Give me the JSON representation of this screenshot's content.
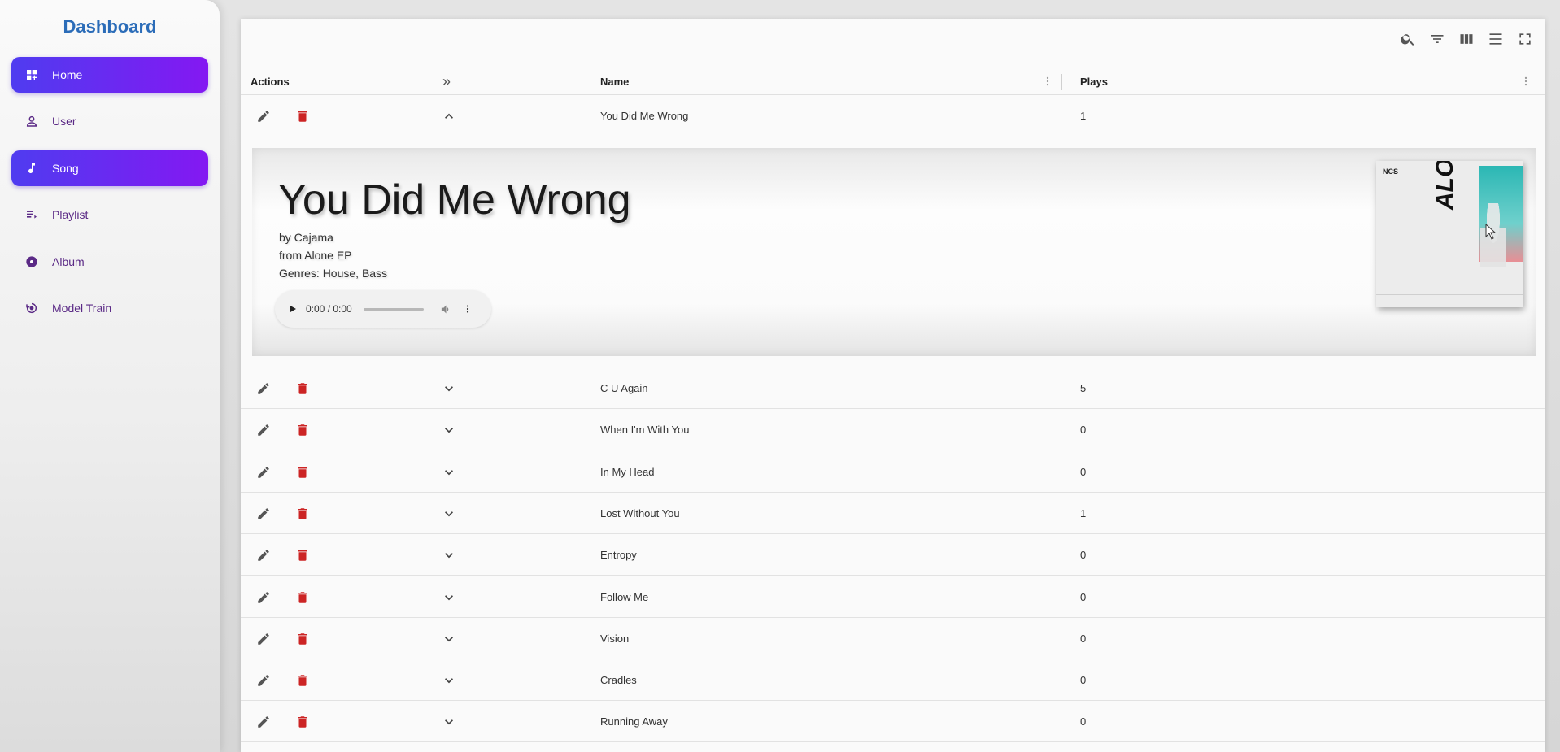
{
  "sidebar": {
    "title": "Dashboard",
    "items": [
      {
        "label": "Home",
        "icon": "dashboard-icon",
        "active": true
      },
      {
        "label": "User",
        "icon": "person-icon",
        "active": false
      },
      {
        "label": "Song",
        "icon": "music-note-icon",
        "active": true
      },
      {
        "label": "Playlist",
        "icon": "playlist-icon",
        "active": false
      },
      {
        "label": "Album",
        "icon": "album-icon",
        "active": false
      },
      {
        "label": "Model Train",
        "icon": "model-training-icon",
        "active": false
      }
    ]
  },
  "toolbar": {
    "icons": [
      "search-icon",
      "filter-icon",
      "columns-icon",
      "density-icon",
      "fullscreen-icon"
    ]
  },
  "table": {
    "headers": {
      "actions": "Actions",
      "expand": "»",
      "name": "Name",
      "plays": "Plays"
    },
    "expanded_row": {
      "name": "You Did Me Wrong",
      "plays": "1"
    },
    "rows": [
      {
        "name": "C U Again",
        "plays": "5"
      },
      {
        "name": "When I'm With You",
        "plays": "0"
      },
      {
        "name": "In My Head",
        "plays": "0"
      },
      {
        "name": "Lost Without You",
        "plays": "1"
      },
      {
        "name": "Entropy",
        "plays": "0"
      },
      {
        "name": "Follow Me",
        "plays": "0"
      },
      {
        "name": "Vision",
        "plays": "0"
      },
      {
        "name": "Cradles",
        "plays": "0"
      },
      {
        "name": "Running Away",
        "plays": "0"
      }
    ]
  },
  "detail": {
    "title": "You Did Me Wrong",
    "artist": "by Cajama",
    "album": "from Alone EP",
    "genres": "Genres: House, Bass",
    "player_time": "0:00 / 0:00",
    "cover": {
      "logo": "NCS",
      "word": "ALONE"
    }
  },
  "colors": {
    "accent_start": "#4f3cf0",
    "accent_end": "#8418f2",
    "title_blue": "#2b6cb8",
    "delete_red": "#cc2424"
  }
}
